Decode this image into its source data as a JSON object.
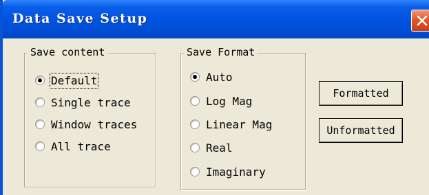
{
  "window": {
    "title": "Data Save Setup"
  },
  "save_content": {
    "legend": "Save content",
    "options": [
      {
        "label": "Default",
        "checked": true
      },
      {
        "label": "Single trace",
        "checked": false
      },
      {
        "label": "Window traces",
        "checked": false
      },
      {
        "label": "All trace",
        "checked": false
      }
    ]
  },
  "save_format": {
    "legend": "Save Format",
    "options": [
      {
        "label": "Auto",
        "checked": true
      },
      {
        "label": "Log Mag",
        "checked": false
      },
      {
        "label": "Linear Mag",
        "checked": false
      },
      {
        "label": "Real",
        "checked": false
      },
      {
        "label": "Imaginary",
        "checked": false
      }
    ]
  },
  "buttons": {
    "formatted": "Formatted",
    "unformatted": "Unformatted"
  },
  "icons": {
    "close": "close-icon"
  },
  "colors": {
    "titlebar": "#0052e0",
    "close": "#e0572a",
    "face": "#ece9d8"
  }
}
